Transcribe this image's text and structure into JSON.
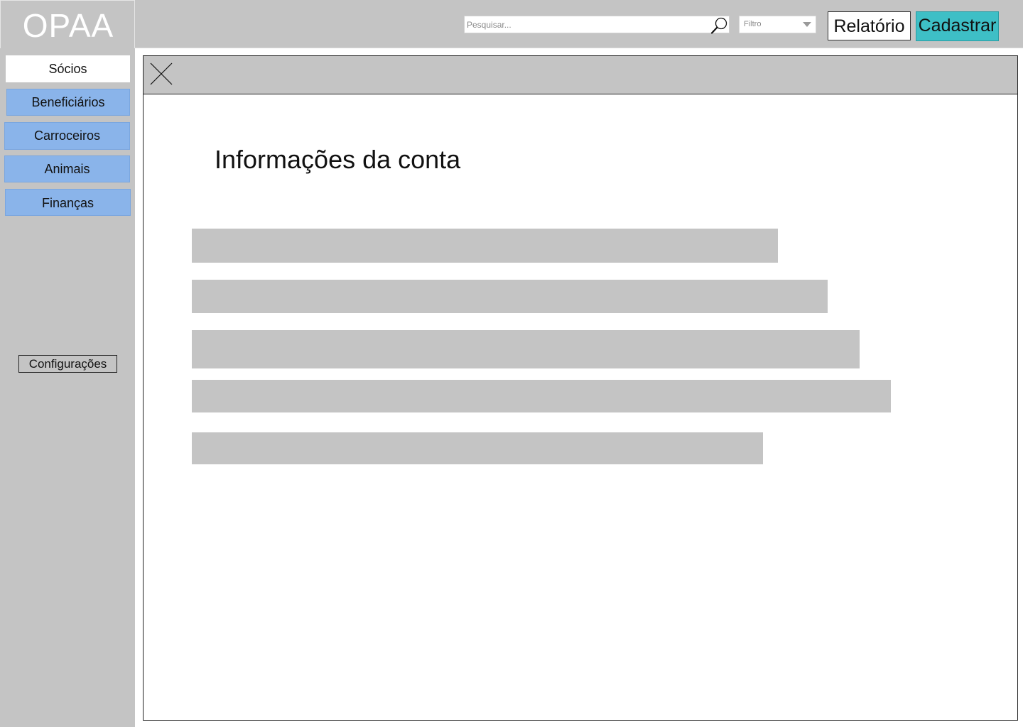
{
  "app": {
    "logo": "OPAA"
  },
  "header": {
    "search": {
      "placeholder": "Pesquisar...",
      "value": ""
    },
    "filter": {
      "label": "Filtro"
    },
    "report_label": "Relatório",
    "register_label": "Cadastrar",
    "colors": {
      "register_button": "#3ebfc6"
    }
  },
  "sidebar": {
    "items": [
      {
        "label": "Sócios",
        "active": true
      },
      {
        "label": "Beneficiários",
        "active": false
      },
      {
        "label": "Carroceiros",
        "active": false
      },
      {
        "label": "Animais",
        "active": false
      },
      {
        "label": "Finanças",
        "active": false
      }
    ],
    "settings_label": "Configurações",
    "colors": {
      "item": "#8ab4ea",
      "active_item": "#ffffff"
    }
  },
  "panel": {
    "title": "Informações da conta",
    "fields": [
      "",
      "",
      "",
      "",
      ""
    ],
    "icons": {
      "close": "close-icon"
    }
  }
}
